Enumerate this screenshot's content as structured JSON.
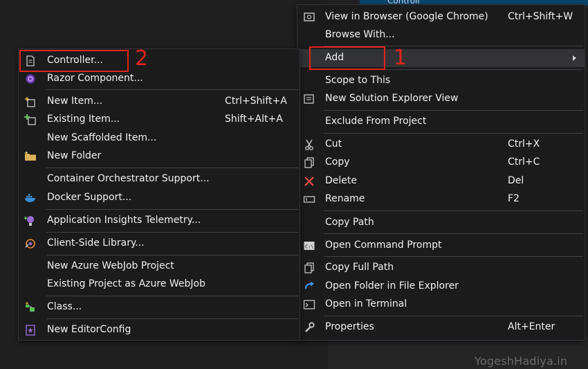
{
  "background": {
    "solution_item": "Controll"
  },
  "main_menu": {
    "items": [
      {
        "label": "View in Browser (Google Chrome)",
        "shortcut": "Ctrl+Shift+W",
        "icon": "browser-icon"
      },
      {
        "label": "Browse With...",
        "shortcut": "",
        "icon": ""
      },
      {
        "label": "Add",
        "shortcut": "",
        "icon": "",
        "submenu": true
      },
      {
        "label": "Scope to This",
        "shortcut": "",
        "icon": ""
      },
      {
        "label": "New Solution Explorer View",
        "shortcut": "",
        "icon": "solution-explorer-icon"
      },
      {
        "label": "Exclude From Project",
        "shortcut": "",
        "icon": ""
      },
      {
        "label": "Cut",
        "shortcut": "Ctrl+X",
        "icon": "scissors-icon"
      },
      {
        "label": "Copy",
        "shortcut": "Ctrl+C",
        "icon": "copy-icon"
      },
      {
        "label": "Delete",
        "shortcut": "Del",
        "icon": "delete-icon"
      },
      {
        "label": "Rename",
        "shortcut": "F2",
        "icon": "rename-icon"
      },
      {
        "label": "Copy Path",
        "shortcut": "",
        "icon": ""
      },
      {
        "label": "Open Command Prompt",
        "shortcut": "",
        "icon": "command-prompt-icon"
      },
      {
        "label": "Copy Full Path",
        "shortcut": "",
        "icon": "copy-icon"
      },
      {
        "label": "Open Folder in File Explorer",
        "shortcut": "",
        "icon": "refresh-arrow-icon"
      },
      {
        "label": "Open in Terminal",
        "shortcut": "",
        "icon": "terminal-icon"
      },
      {
        "label": "Properties",
        "shortcut": "Alt+Enter",
        "icon": "wrench-icon"
      }
    ]
  },
  "sub_menu": {
    "items": [
      {
        "label": "Controller...",
        "shortcut": "",
        "icon": "document-icon"
      },
      {
        "label": "Razor Component...",
        "shortcut": "",
        "icon": "razor-icon"
      },
      {
        "label": "New Item...",
        "shortcut": "Ctrl+Shift+A",
        "icon": "new-item-icon"
      },
      {
        "label": "Existing Item...",
        "shortcut": "Shift+Alt+A",
        "icon": "existing-item-icon"
      },
      {
        "label": "New Scaffolded Item...",
        "shortcut": "",
        "icon": ""
      },
      {
        "label": "New Folder",
        "shortcut": "",
        "icon": "folder-icon"
      },
      {
        "label": "Container Orchestrator Support...",
        "shortcut": "",
        "icon": ""
      },
      {
        "label": "Docker Support...",
        "shortcut": "",
        "icon": "docker-icon"
      },
      {
        "label": "Application Insights Telemetry...",
        "shortcut": "",
        "icon": "insights-icon"
      },
      {
        "label": "Client-Side Library...",
        "shortcut": "",
        "icon": "library-icon"
      },
      {
        "label": "New Azure WebJob Project",
        "shortcut": "",
        "icon": ""
      },
      {
        "label": "Existing Project as Azure WebJob",
        "shortcut": "",
        "icon": ""
      },
      {
        "label": "Class...",
        "shortcut": "",
        "icon": "class-icon"
      },
      {
        "label": "New EditorConfig",
        "shortcut": "",
        "icon": "editorconfig-icon"
      }
    ]
  },
  "annotations": {
    "step1": "1",
    "step2": "2",
    "color": "#e0241b"
  },
  "watermark": "YogeshHadiya.in"
}
